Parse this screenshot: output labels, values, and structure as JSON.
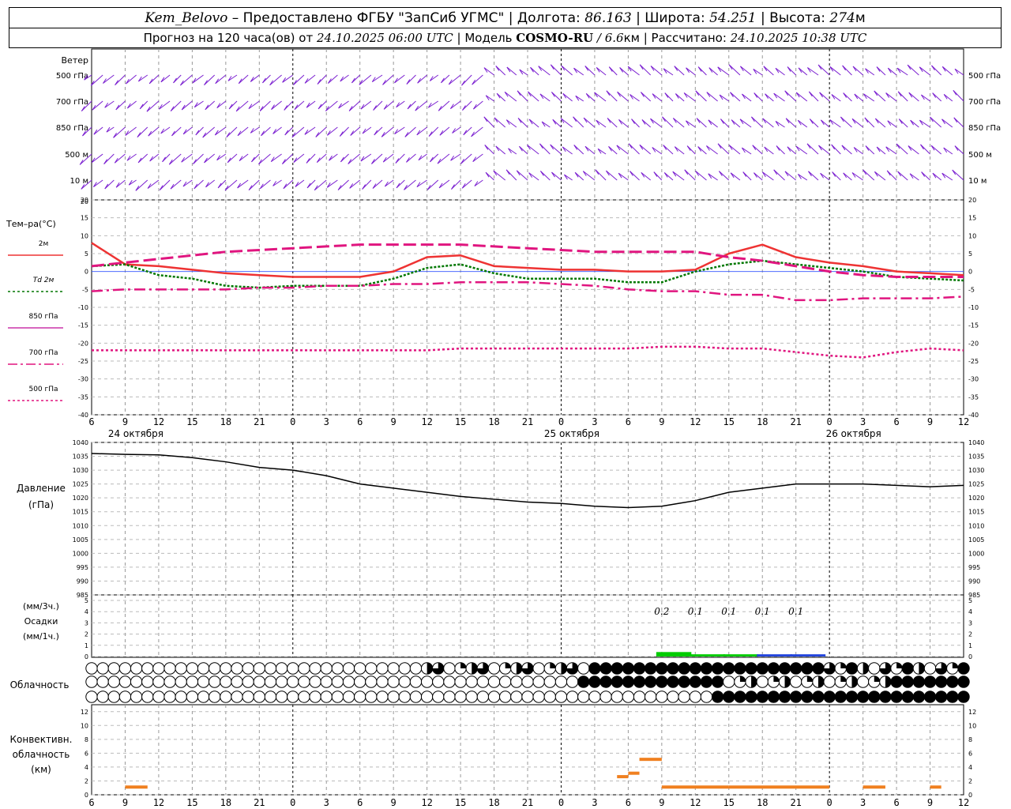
{
  "header": {
    "station": "Kem_Belovo",
    "provider": " – Предоставлено ФГБУ \"ЗапСиб УГМС\" | Долгота: ",
    "lon": "86.163",
    "lat_label": " | Широта: ",
    "lat": "54.251",
    "alt_label": " | Высота: ",
    "alt": "274",
    "alt_unit": "м",
    "forecast_prefix": "Прогноз на 120 часа(ов) от ",
    "forecast_time": "24.10.2025 06:00 UTC",
    "model_label": "  | Модель ",
    "model": "COSMO-RU",
    "model_res": " / 6.6",
    "model_res_unit": "км",
    "calc_label": " | Рассчитано: ",
    "calc_time": "24.10.2025 10:38 UTC"
  },
  "panels": {
    "wind": {
      "title": "Ветер",
      "levels": [
        "500 гПа",
        "700 гПа",
        "850 гПа",
        "500 м",
        "10 м"
      ]
    },
    "temp": {
      "title": "Тем–ра(°С)",
      "legend": [
        {
          "label": "2м",
          "color": "#ee3333",
          "dash": ""
        },
        {
          "label": "Td  2м",
          "color": "#007700",
          "dash": "3,3"
        },
        {
          "label": "850 гПа",
          "color": "#cc33aa",
          "dash": ""
        },
        {
          "label": "700 гПа",
          "color": "#e0157f",
          "dash": "12,4,3,4"
        },
        {
          "label": "500 гПа",
          "color": "#e0157f",
          "dash": "3,3"
        }
      ],
      "ticks": [
        "20",
        "15",
        "10",
        "5",
        "0",
        "-5",
        "-10",
        "-15",
        "-20",
        "-25",
        "-30",
        "-35",
        "-40"
      ]
    },
    "pressure": {
      "title1": "Давление",
      "title2": "(гПа)",
      "ticks": [
        "1040",
        "1035",
        "1030",
        "1025",
        "1020",
        "1015",
        "1010",
        "1005",
        "1000",
        "995",
        "990",
        "985"
      ]
    },
    "precip": {
      "title1": "(мм/3ч.)",
      "title2": "Осадки",
      "title3": "(мм/1ч.)",
      "ticks": [
        "5",
        "4",
        "3",
        "2",
        "1",
        "0"
      ],
      "labels": [
        "0.2",
        "0.1",
        "0.1",
        "0.1",
        "0.1"
      ]
    },
    "cloud": {
      "title": "Облачность"
    },
    "conv": {
      "title1": "Конвективн.",
      "title2": "облачность",
      "title3": "(км)",
      "ticks": [
        "12",
        "10",
        "8",
        "6",
        "4",
        "2",
        "0"
      ]
    },
    "dates": [
      "24 октября",
      "25 октября",
      "26 октября"
    ],
    "hour_ticks": [
      "6",
      "9",
      "12",
      "15",
      "18",
      "21",
      "0",
      "3",
      "6",
      "9",
      "12",
      "15",
      "18",
      "21",
      "0",
      "3",
      "6",
      "9",
      "12",
      "15",
      "18",
      "21",
      "0",
      "3",
      "6",
      "9",
      "12"
    ]
  },
  "chart_data": {
    "type": "line",
    "x_unit": "forecast hour from 24.10.2025 06:00 UTC",
    "x": [
      0,
      3,
      6,
      9,
      12,
      15,
      18,
      21,
      24,
      27,
      30,
      33,
      36,
      39,
      42,
      45,
      48,
      51,
      54,
      57,
      60,
      63,
      66,
      69,
      72,
      75,
      78
    ],
    "series": [
      {
        "name": "2м",
        "values": [
          8,
          2,
          1.5,
          0.5,
          -0.5,
          -1,
          -1.5,
          -1.5,
          -1.5,
          0,
          4,
          4.5,
          1.5,
          1,
          0.5,
          0.5,
          0,
          0,
          0.5,
          5,
          7.5,
          4,
          2.5,
          1.5,
          0,
          -0.5,
          -1
        ]
      },
      {
        "name": "Td  2м",
        "values": [
          1.5,
          2,
          -1,
          -2,
          -4,
          -4.5,
          -4,
          -4,
          -4,
          -2,
          1,
          2,
          -0.5,
          -2,
          -2,
          -2,
          -3,
          -3,
          0,
          2,
          3,
          2,
          1,
          0,
          -1.5,
          -2,
          -2.5
        ]
      },
      {
        "name": "850 гПа",
        "values": [
          1.5,
          2.5,
          3.5,
          4.5,
          5.5,
          6,
          6.5,
          7,
          7.5,
          7.5,
          7.5,
          7.5,
          7,
          6.5,
          6,
          5.5,
          5.5,
          5.5,
          5.5,
          4,
          3,
          1.5,
          0,
          -1,
          -1.5,
          -1.5,
          -1.5
        ]
      },
      {
        "name": "700 гПа",
        "values": [
          -5.5,
          -5,
          -5,
          -5,
          -5,
          -4.5,
          -4.5,
          -4,
          -4,
          -3.5,
          -3.5,
          -3,
          -3,
          -3,
          -3.5,
          -4,
          -5,
          -5.5,
          -5.5,
          -6.5,
          -6.5,
          -8,
          -8,
          -7.5,
          -7.5,
          -7.5,
          -7
        ]
      },
      {
        "name": "500 гПа",
        "values": [
          -22,
          -22,
          -22,
          -22,
          -22,
          -22,
          -22,
          -22,
          -22,
          -22,
          -22,
          -21.5,
          -21.5,
          -21.5,
          -21.5,
          -21.5,
          -21.5,
          -21,
          -21,
          -21.5,
          -21.5,
          -22.5,
          -23.5,
          -24,
          -22.5,
          -21.5,
          -22
        ]
      },
      {
        "name": "pressure",
        "values": [
          1036,
          1035.7,
          1035.5,
          1034.5,
          1033,
          1031,
          1030,
          1028,
          1025,
          1023.5,
          1022,
          1020.5,
          1019.5,
          1018.5,
          1018,
          1017,
          1016.5,
          1017,
          1019,
          1022,
          1023.5,
          1025,
          1025,
          1025,
          1024.5,
          1024,
          1024.5
        ]
      }
    ],
    "precip_mm_3h": [
      {
        "x": 51,
        "value": 0.2,
        "label": "0.2"
      },
      {
        "x": 54,
        "value": 0.1,
        "label": "0.1"
      },
      {
        "x": 57,
        "value": 0.1,
        "label": "0.1"
      },
      {
        "x": 60,
        "value": 0.1,
        "label": "0.1"
      },
      {
        "x": 63,
        "value": 0.1,
        "label": "0.1"
      }
    ],
    "conv_cloud_km": [
      {
        "x0": 3,
        "x1": 5,
        "value": 1
      },
      {
        "x0": 47,
        "x1": 48,
        "value": 2.5
      },
      {
        "x0": 48,
        "x1": 49,
        "value": 3
      },
      {
        "x0": 49,
        "x1": 51,
        "value": 5
      },
      {
        "x0": 51,
        "x1": 57,
        "value": 1
      },
      {
        "x0": 57,
        "x1": 66,
        "value": 1
      },
      {
        "x0": 69,
        "x1": 71,
        "value": 1
      },
      {
        "x0": 75,
        "x1": 76,
        "value": 1
      }
    ],
    "ylim_temp": [
      -40,
      20
    ],
    "ylim_pressure": [
      985,
      1040
    ],
    "ylim_precip": [
      0,
      5
    ],
    "ylim_conv": [
      0,
      13
    ],
    "grid": true
  }
}
